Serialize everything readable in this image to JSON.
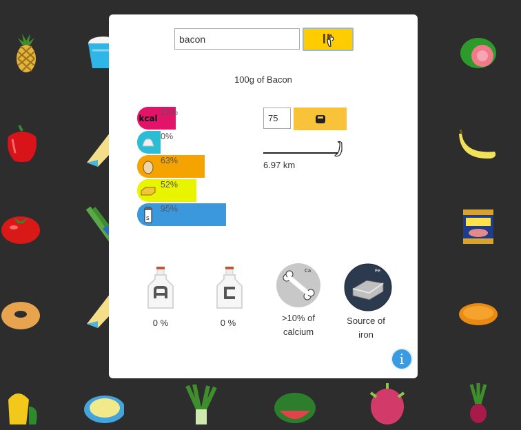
{
  "search": {
    "value": "bacon",
    "button_icon": "fork-knife-icon"
  },
  "subtitle": "100g of Bacon",
  "nutrients": [
    {
      "name": "calories",
      "icon": "kcal-icon",
      "percent": 21,
      "label": "21%",
      "color": "#e2146a"
    },
    {
      "name": "sugar",
      "icon": "sugar-icon",
      "percent": 0,
      "label": "0%",
      "color": "#2bbcd6"
    },
    {
      "name": "protein",
      "icon": "egg-icon",
      "percent": 63,
      "label": "63%",
      "color": "#f5a300"
    },
    {
      "name": "fat",
      "icon": "butter-icon",
      "percent": 52,
      "label": "52%",
      "color": "#e8f400"
    },
    {
      "name": "salt",
      "icon": "salt-icon",
      "percent": 95,
      "label": "95%",
      "color": "#3b98dc"
    }
  ],
  "activity": {
    "minutes_value": "75",
    "button_icon": "scale-icon",
    "slider_icon": "leg-icon",
    "distance": "6.97 km"
  },
  "vitamins": {
    "a": {
      "label": "0 %",
      "icon": "vitamin-a-bottle-icon"
    },
    "c": {
      "label": "0 %",
      "icon": "vitamin-c-bottle-icon"
    },
    "calcium": {
      "line1": ">10% of",
      "line2": "calcium",
      "badge": "Ca",
      "icon": "bone-icon"
    },
    "iron": {
      "line1": "Source of",
      "line2": "iron",
      "badge": "Fe",
      "icon": "iron-bar-icon"
    }
  },
  "info_label": "i",
  "colors": {
    "accent": "#ffcc00",
    "background": "#2d2d2d",
    "info": "#3a9be0"
  }
}
